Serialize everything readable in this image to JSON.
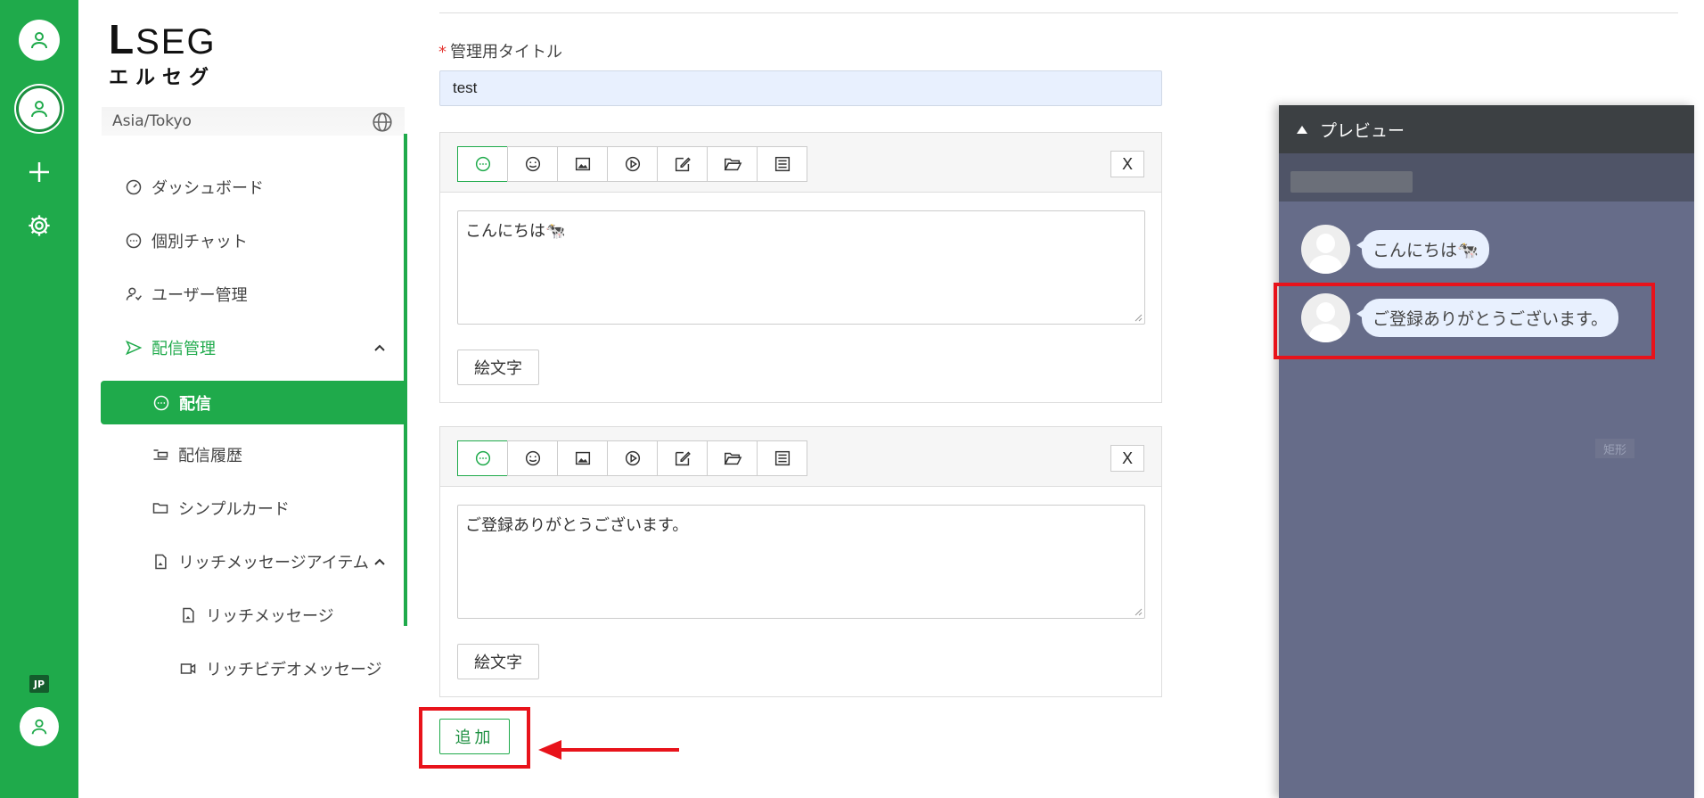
{
  "rail": {
    "lang_badge": "JP"
  },
  "brand": {
    "logo_line1_big": "L",
    "logo_line1_rest": "SEG",
    "logo_line2": "エルセグ"
  },
  "timezone": {
    "value": "Asia/Tokyo"
  },
  "sidebar": {
    "items": [
      {
        "label": "ダッシュボード",
        "icon": "gauge-icon"
      },
      {
        "label": "個別チャット",
        "icon": "chat-bubble-icon"
      },
      {
        "label": "ユーザー管理",
        "icon": "user-manage-icon"
      },
      {
        "label": "配信管理",
        "icon": "send-icon"
      },
      {
        "label": "配信",
        "icon": "chat-bubble-icon"
      },
      {
        "label": "配信履歴",
        "icon": "history-icon"
      },
      {
        "label": "シンプルカード",
        "icon": "folder-icon"
      },
      {
        "label": "リッチメッセージアイテム",
        "icon": "file-image-icon"
      },
      {
        "label": "リッチメッセージ",
        "icon": "file-image-icon"
      },
      {
        "label": "リッチビデオメッセージ",
        "icon": "video-icon"
      }
    ]
  },
  "form": {
    "title_label": "管理用タイトル",
    "required_mark": "*",
    "title_value": "test"
  },
  "messages": [
    {
      "text": "こんにちは🐄",
      "emoji_button": "絵文字",
      "close_button": "X"
    },
    {
      "text": "ご登録ありがとうございます。",
      "emoji_button": "絵文字",
      "close_button": "X"
    }
  ],
  "add_button": "追加",
  "preview": {
    "title": "プレビュー",
    "bubbles": [
      "こんにちは🐄",
      "ご登録ありがとうございます。"
    ],
    "shape_label": "矩形"
  },
  "colors": {
    "brand_green": "#1faa4b",
    "highlight_red": "#e8131b",
    "preview_bg": "#666c89"
  }
}
